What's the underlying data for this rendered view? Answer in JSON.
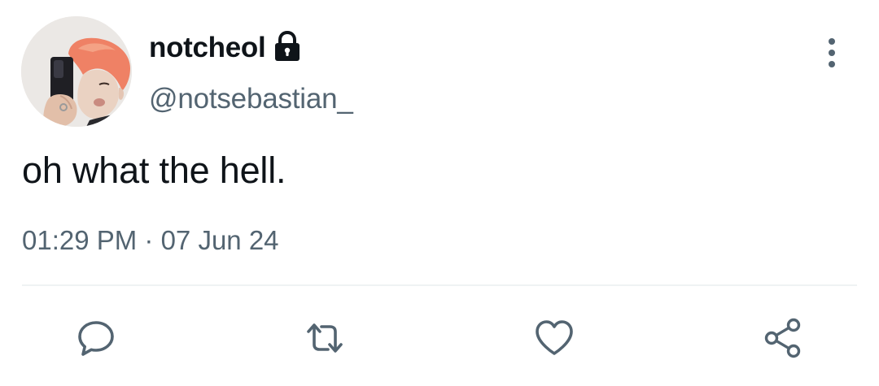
{
  "user": {
    "display_name": "notcheol",
    "handle": "@notsebastian_",
    "protected_icon": "lock-icon",
    "avatar": "profile-photo"
  },
  "tweet": {
    "text": "oh what the hell.",
    "time": "01:29 PM",
    "separator": " · ",
    "date": "07 Jun 24"
  },
  "menu": {
    "icon": "more-vertical-icon"
  },
  "actions": [
    {
      "name": "reply",
      "icon": "comment-icon"
    },
    {
      "name": "retweet",
      "icon": "retweet-icon"
    },
    {
      "name": "like",
      "icon": "heart-icon"
    },
    {
      "name": "share",
      "icon": "share-icon"
    }
  ],
  "colors": {
    "text_primary": "#0f1419",
    "text_secondary": "#536471",
    "divider": "#eff3f4",
    "icon": "#536471",
    "background": "#ffffff"
  }
}
